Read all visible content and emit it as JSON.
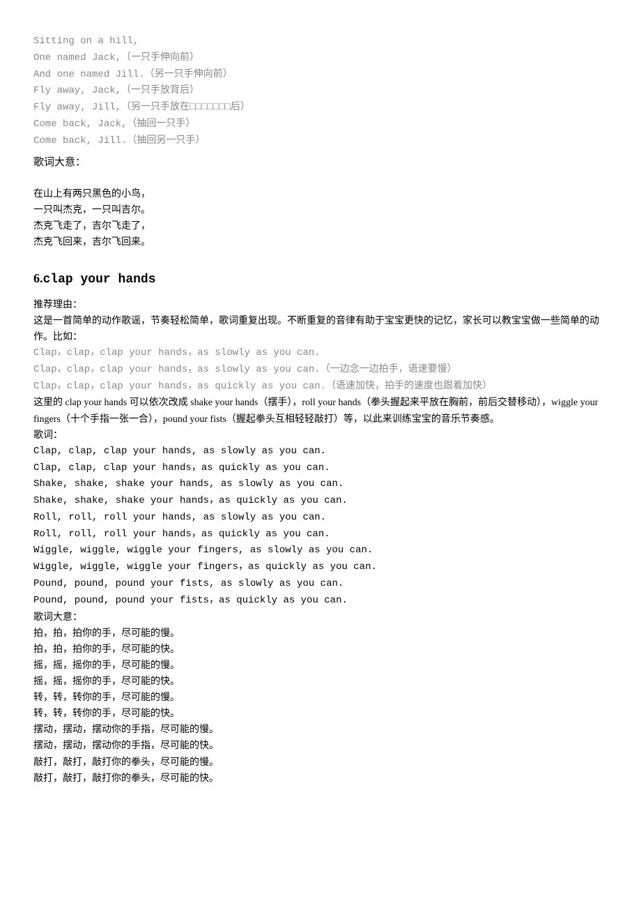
{
  "section5": {
    "lyrics_en": [
      "Sitting on a hill,",
      "One named Jack,（一只手伸向前）",
      "And one named Jill.（另一只手伸向前）",
      "Fly away, Jack,（一只手放背后）",
      "Fly away, Jill,（另一只手放在□□□□□□□后）",
      "Come back, Jack,（抽回一只手）",
      "Come back, Jill.（抽回另一只手）"
    ],
    "meaning_label": "歌词大意：",
    "meaning_lines": [
      "在山上有两只黑色的小鸟，",
      "一只叫杰克，一只叫吉尔。",
      "杰克飞走了，吉尔飞走了，",
      "杰克飞回来，吉尔飞回来。"
    ]
  },
  "section6": {
    "number": "6.",
    "title": "clap your hands",
    "recommend_label": "推荐理由：",
    "recommend_text": "这是一首简单的动作歌谣，节奏轻松简单，歌词重复出现。不断重复的音律有助于宝宝更快的记忆，家长可以教宝宝做一些简单的动作。比如：",
    "example_lines": [
      "Clap，clap，clap your hands，as slowly as you can.",
      "Clap，clap，clap your hands，as slowly as you can.（一边念一边拍手，语速要慢）",
      "Clap，clap，clap your hands，as quickly as you can.（语速加快，拍手的速度也跟着加快）"
    ],
    "explain_text": "这里的 clap your hands 可以依次改成 shake your hands（摆手），roll your hands（拳头握起来平放在胸前，前后交替移动），wiggle your fingers（十个手指一张一合），pound your fists（握起拳头互相轻轻敲打）等，以此来训练宝宝的音乐节奏感。",
    "lyrics_label": "歌词：",
    "lyrics_en": [
      "Clap, clap, clap your hands, as slowly as you can.",
      "Clap, clap, clap your hands，as quickly as you can.",
      "Shake, shake, shake your hands, as slowly as you can.",
      "Shake, shake, shake your hands，as quickly as you can.",
      "Roll, roll, roll your hands, as slowly as you can.",
      "Roll, roll, roll your hands，as quickly as you can.",
      "Wiggle, wiggle, wiggle your fingers, as slowly as you can.",
      "Wiggle, wiggle, wiggle your fingers，as quickly as you can.",
      "Pound, pound, pound your fists, as slowly as you can.",
      "Pound, pound, pound your fists，as quickly as you can."
    ],
    "meaning_label": "歌词大意：",
    "meaning_lines": [
      "拍，拍，拍你的手，尽可能的慢。",
      "拍，拍，拍你的手，尽可能的快。",
      "摇，摇，摇你的手，尽可能的慢。",
      "摇，摇，摇你的手，尽可能的快。",
      "转，转，转你的手，尽可能的慢。",
      "转，转，转你的手，尽可能的快。",
      "摆动，摆动，摆动你的手指，尽可能的慢。",
      "摆动，摆动，摆动你的手指，尽可能的快。",
      "敲打，敲打，敲打你的拳头，尽可能的慢。",
      "敲打，敲打，敲打你的拳头，尽可能的快。"
    ]
  }
}
